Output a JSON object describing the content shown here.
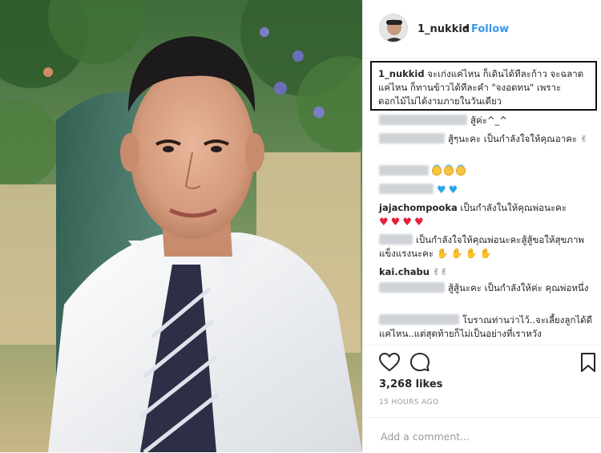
{
  "post": {
    "username": "1_nukkid",
    "follow_label": "Follow",
    "separator": "•"
  },
  "caption": {
    "username": "1_nukkid",
    "text": " จะเก่งแค่ไหน ก็เดินได้ทีละก้าว จะฉลาดแค่ไหน ก็ทานข้าวได้ทีละคำ \"จงอดทน\" เพราะ ดอกไม้ไม่ได้งามภายในวันเดียว"
  },
  "comments": [
    {
      "user": "",
      "text": "สู้ค่ะ^_^"
    },
    {
      "user": "",
      "text": "สู้ๆนะคะ เป็นกำลังใจให้คุณอาคะ"
    },
    {
      "user": "",
      "text": ""
    },
    {
      "user": "",
      "text": ""
    },
    {
      "user": "jajachompooka",
      "text": "เป็นกำลังในให้คุณพ่อนะคะ"
    },
    {
      "user": "",
      "text": "เป็นกำลังใจให้คุณพ่อนะคะสู้สู้ขอให้สุขภาพแข็งแรงนะคะ"
    },
    {
      "user": "kai.chabu",
      "text": ""
    },
    {
      "user": "",
      "text": "สู้สู้นะคะ เป็นกำลังให้ค่ะ คุณพ่อหนึ่ง"
    },
    {
      "user": "",
      "text": "โบราณท่านว่าไว้..จะเลี้ยงลูกได้ดีแค่ไหน..แต่สุดท้ายก็ไม่เป็นอย่างที่เราหวัง"
    }
  ],
  "icons": {
    "like": "heart-outline-icon",
    "comment": "speech-bubble-icon",
    "save": "bookmark-icon"
  },
  "stats": {
    "likes": "3,268 likes",
    "time": "15 HOURS AGO"
  },
  "add_comment": {
    "placeholder": "Add a comment..."
  },
  "colors": {
    "accent": "#3897f0",
    "text": "#262626",
    "muted": "#999999",
    "border": "#efefef"
  }
}
